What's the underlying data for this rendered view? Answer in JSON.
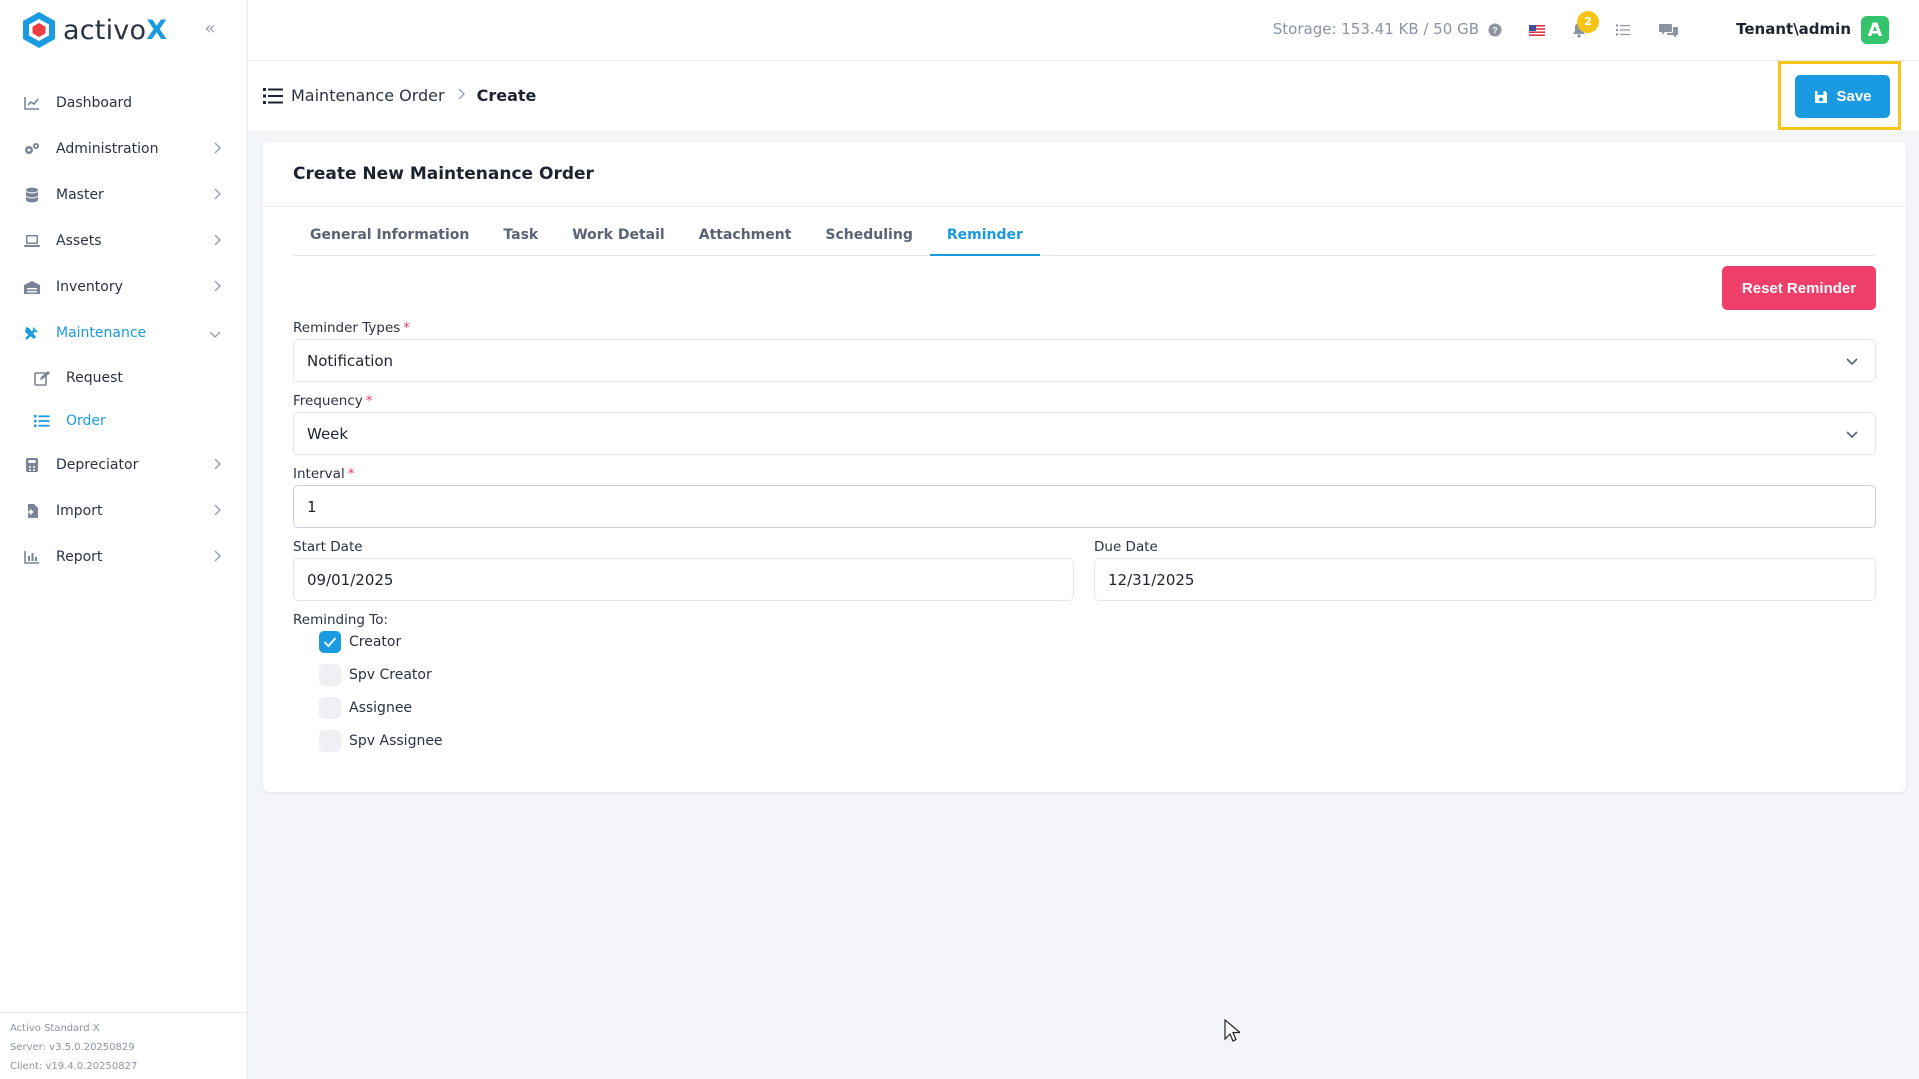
{
  "brand": {
    "prefix": "activo",
    "suffix": "X"
  },
  "sidebar": {
    "items": [
      {
        "label": "Dashboard",
        "icon": "chart-line-icon",
        "has_chevron": false
      },
      {
        "label": "Administration",
        "icon": "gears-icon",
        "has_chevron": true
      },
      {
        "label": "Master",
        "icon": "database-icon",
        "has_chevron": true
      },
      {
        "label": "Assets",
        "icon": "laptop-icon",
        "has_chevron": true
      },
      {
        "label": "Inventory",
        "icon": "warehouse-icon",
        "has_chevron": true
      },
      {
        "label": "Maintenance",
        "icon": "tools-icon",
        "has_chevron": true,
        "expanded": true,
        "active": true
      },
      {
        "label": "Depreciator",
        "icon": "calculator-icon",
        "has_chevron": true
      },
      {
        "label": "Import",
        "icon": "file-import-icon",
        "has_chevron": true
      },
      {
        "label": "Report",
        "icon": "chart-bar-icon",
        "has_chevron": true
      }
    ],
    "maintenance_children": [
      {
        "label": "Request",
        "icon": "edit-icon"
      },
      {
        "label": "Order",
        "icon": "list-icon",
        "active": true
      }
    ],
    "footer": {
      "product": "Activo Standard X",
      "server": "Server: v3.5.0.20250829",
      "client": "Client: v19.4.0.20250827"
    }
  },
  "topbar": {
    "storage": "Storage: 153.41 KB / 50 GB",
    "notifications_count": "2",
    "user": "Tenant\\admin",
    "avatar_letter": "A"
  },
  "breadcrumb": {
    "parent": "Maintenance Order",
    "current": "Create"
  },
  "toolbar": {
    "save_label": "Save"
  },
  "card": {
    "title": "Create New Maintenance Order",
    "tabs": [
      "General Information",
      "Task",
      "Work Detail",
      "Attachment",
      "Scheduling",
      "Reminder"
    ],
    "active_tab": "Reminder",
    "reset_label": "Reset Reminder"
  },
  "form": {
    "reminder_types": {
      "label": "Reminder Types",
      "value": "Notification"
    },
    "frequency": {
      "label": "Frequency",
      "value": "Week"
    },
    "interval": {
      "label": "Interval",
      "value": "1"
    },
    "start_date": {
      "label": "Start Date",
      "value": "09/01/2025"
    },
    "due_date": {
      "label": "Due Date",
      "value": "12/31/2025"
    },
    "reminding_to": {
      "label": "Reminding To:",
      "options": [
        {
          "label": "Creator",
          "checked": true
        },
        {
          "label": "Spv Creator",
          "checked": false
        },
        {
          "label": "Assignee",
          "checked": false
        },
        {
          "label": "Spv Assignee",
          "checked": false
        }
      ]
    }
  },
  "colors": {
    "accent": "#1a9ae0",
    "danger": "#ee3e69",
    "highlight": "#f5c518",
    "avatar": "#34c46b",
    "badge": "#f6c417"
  }
}
